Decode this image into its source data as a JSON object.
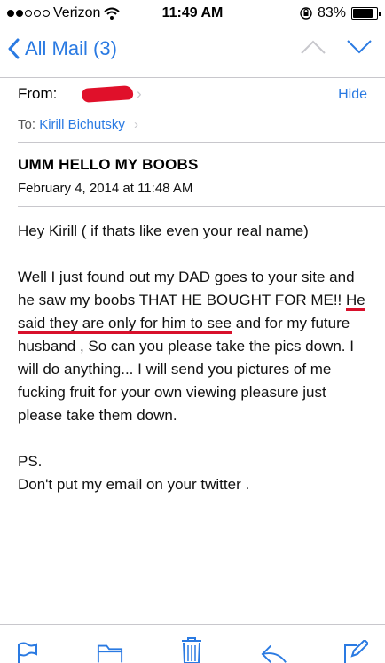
{
  "status_bar": {
    "carrier": "Verizon",
    "time": "11:49 AM",
    "battery": "83%",
    "battery_level": 0.83
  },
  "nav": {
    "back_label": "All Mail (3)"
  },
  "header": {
    "from_label": "From:",
    "hide_label": "Hide",
    "to_label": "To:",
    "to_name": "Kirill Bichutsky",
    "subject": "UMM HELLO MY BOOBS",
    "date": "February 4, 2014 at 11:48 AM"
  },
  "body": {
    "greeting": "Hey Kirill ( if thats like even your real name)",
    "para_start": "Well I just found out my DAD goes to your site and he saw my boobs THAT HE BOUGHT FOR ME!! ",
    "para_underlined": "He said they are only for him to see",
    "para_end": " and for my future husband , So can you please take the pics down. I will do anything... I will send you pictures of me fucking fruit for your own viewing pleasure just please take them down.",
    "ps": "PS.",
    "closing": "Don't put my email on your twitter ."
  },
  "toolbar": {
    "icons": [
      "flag-icon",
      "folder-icon",
      "trash-icon",
      "reply-icon",
      "compose-icon"
    ]
  },
  "colors": {
    "accent": "#2a7ae2",
    "redaction": "#e0102a",
    "underline": "#d8102b"
  }
}
